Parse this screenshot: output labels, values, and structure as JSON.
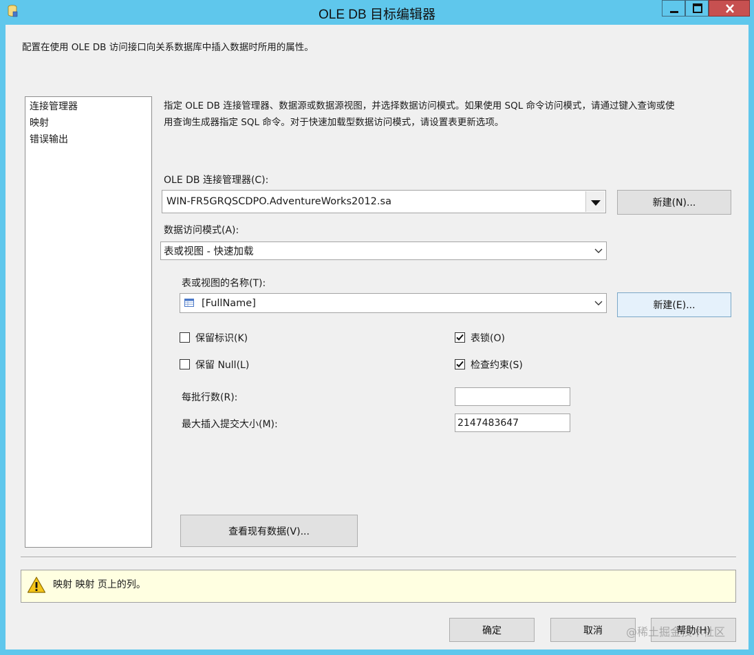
{
  "window": {
    "title": "OLE DB 目标编辑器",
    "controls": {
      "minimize": "minimize",
      "maximize": "maximize",
      "close": "close"
    }
  },
  "description": "配置在使用 OLE DB 访问接口向关系数据库中插入数据时所用的属性。",
  "nav": {
    "items": [
      {
        "label": "连接管理器"
      },
      {
        "label": "映射"
      },
      {
        "label": "错误输出"
      }
    ]
  },
  "main": {
    "instructions_line1": "指定 OLE DB 连接管理器、数据源或数据源视图，并选择数据访问模式。如果使用 SQL 命令访问模式，请通过键入查询或使",
    "instructions_line2": "用查询生成器指定 SQL 命令。对于快速加载型数据访问模式，请设置表更新选项。",
    "connection_label": "OLE DB 连接管理器(C):",
    "connection_value": "WIN-FR5GRQSCDPO.AdventureWorks2012.sa",
    "new_connection_button": "新建(N)...",
    "access_mode_label": "数据访问模式(A):",
    "access_mode_value": "表或视图 - 快速加载",
    "table_label": "表或视图的名称(T):",
    "table_value": "[FullName]",
    "new_table_button": "新建(E)...",
    "keep_identity_label": "保留标识(K)",
    "keep_identity_checked": false,
    "table_lock_label": "表锁(O)",
    "table_lock_checked": true,
    "keep_nulls_label": "保留 Null(L)",
    "keep_nulls_checked": false,
    "check_constraints_label": "检查约束(S)",
    "check_constraints_checked": true,
    "rows_per_batch_label": "每批行数(R):",
    "rows_per_batch_value": "",
    "max_commit_label": "最大插入提交大小(M):",
    "max_commit_value": "2147483647",
    "view_data_button": "查看现有数据(V)..."
  },
  "message": {
    "icon": "warning-icon",
    "text": "映射 映射 页上的列。"
  },
  "footer": {
    "ok_button": "确定",
    "cancel_button": "取消",
    "help_button": "帮助(H)"
  },
  "watermark": "@稀土掘金技术社区"
}
